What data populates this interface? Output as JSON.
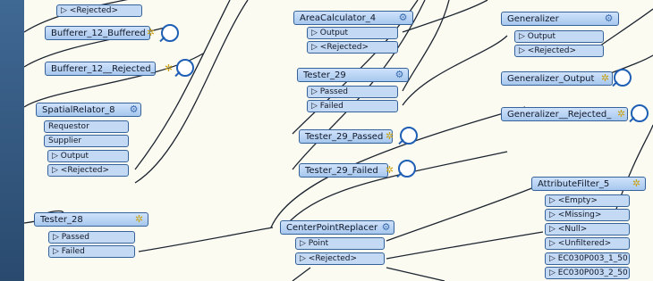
{
  "nodes": {
    "top_rejected": "▷ <Rejected>",
    "bufferer_buffered": "Bufferer_12_Buffered",
    "bufferer_rejected": "Bufferer_12__Rejected_",
    "spatial_relator": {
      "title": "SpatialRelator_8",
      "ports": [
        "Requestor",
        "Supplier",
        "▷ Output",
        "▷ <Rejected>"
      ]
    },
    "tester_28": {
      "title": "Tester_28",
      "ports": [
        "▷ Passed",
        "▷ Failed"
      ]
    },
    "area_calc": {
      "title": "AreaCalculator_4",
      "ports": [
        "▷ Output",
        "▷ <Rejected>"
      ]
    },
    "tester_29": {
      "title": "Tester_29",
      "ports": [
        "▷ Passed",
        "▷ Failed"
      ]
    },
    "tester_29_passed": "Tester_29_Passed",
    "tester_29_failed": "Tester_29_Failed",
    "center_point": {
      "title": "CenterPointReplacer",
      "ports": [
        "▷ Point",
        "▷ <Rejected>"
      ]
    },
    "generalizer": {
      "title": "Generalizer",
      "ports": [
        "▷ Output",
        "▷ <Rejected>"
      ]
    },
    "generalizer_output": "Generalizer_Output",
    "generalizer_rejected": "Generalizer__Rejected_",
    "attribute_filter": {
      "title": "AttributeFilter_5",
      "ports": [
        "▷ <Empty>",
        "▷ <Missing>",
        "▷ <Null>",
        "▷ <Unfiltered>",
        "▷ EC030P003_1_50",
        "▷ EC030P003_2_50"
      ]
    }
  },
  "icons": {
    "gear": "gear-icon",
    "magnifier": "magnifier-icon"
  },
  "colors": {
    "canvas": "#fbfbf1",
    "node_header": "#a7c7ee",
    "node_border": "#35629a",
    "wire": "#1c2430",
    "frame": "#2e5277"
  }
}
